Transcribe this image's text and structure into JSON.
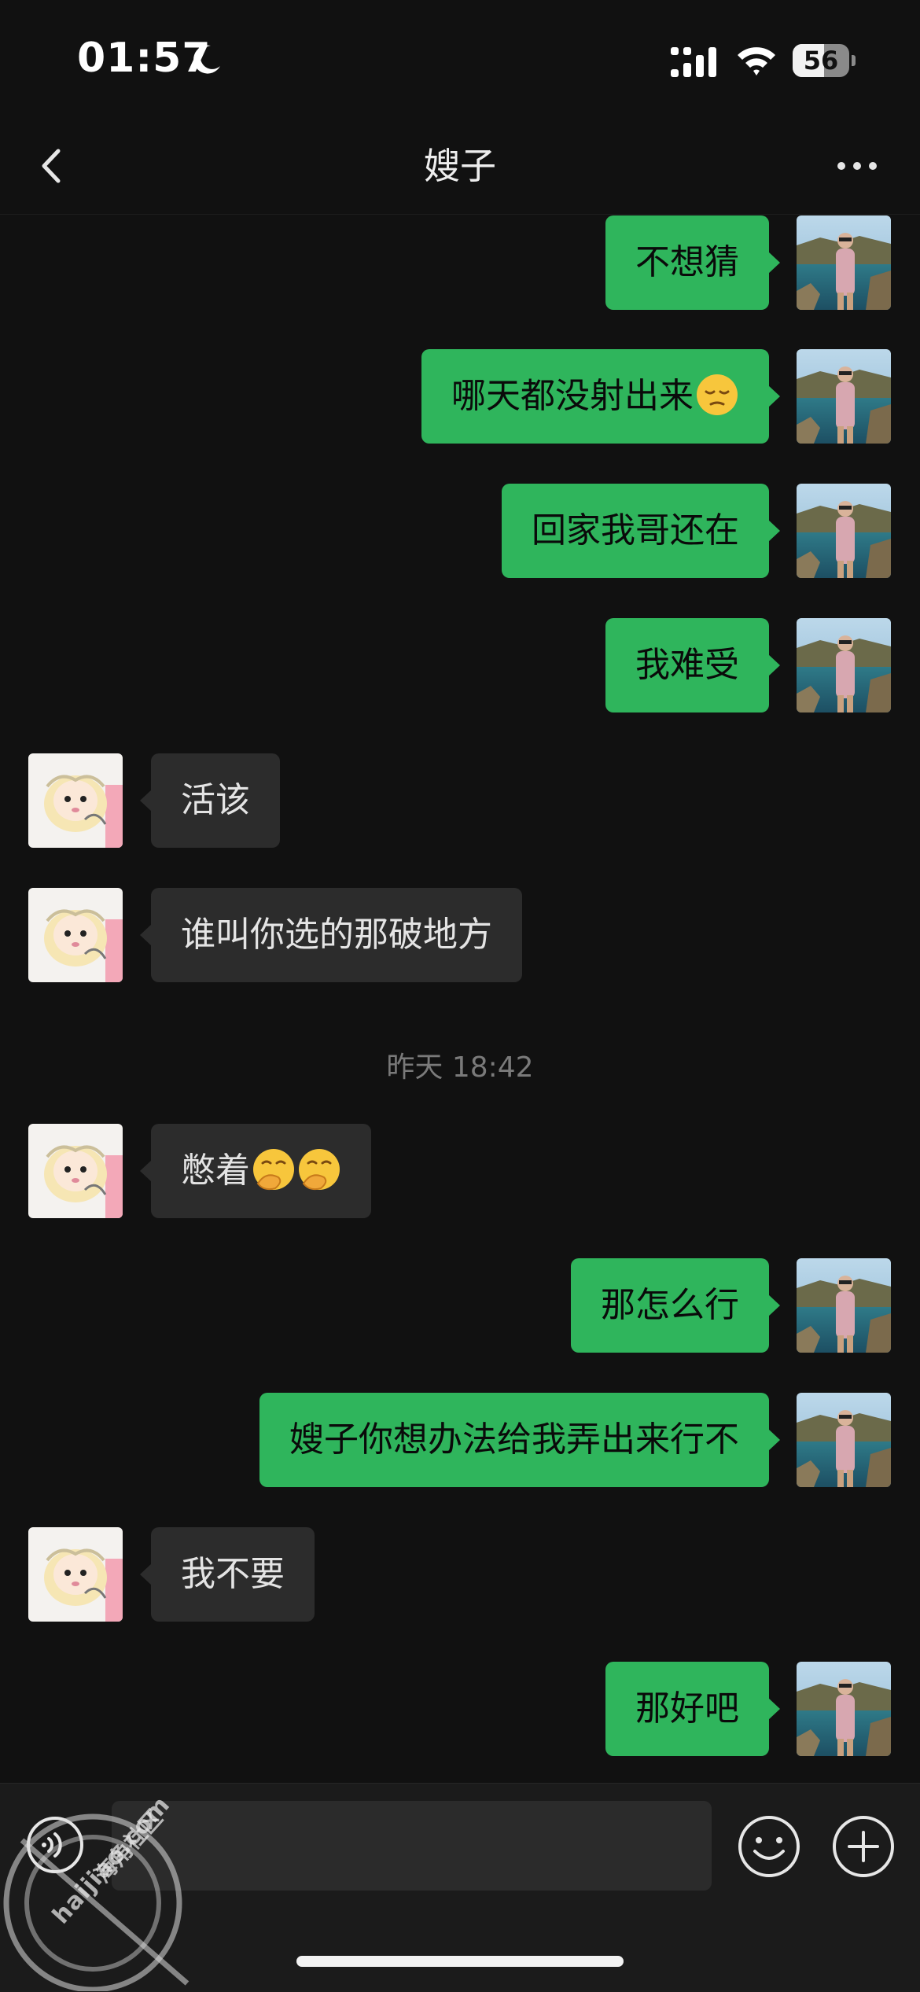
{
  "status_bar": {
    "time": "01:57",
    "battery_level": "56",
    "battery_fraction": 0.56,
    "icons": [
      "moon-icon",
      "signal-icon",
      "wifi-icon",
      "battery-icon"
    ]
  },
  "nav": {
    "title": "嫂子",
    "back_icon": "chevron-left-icon",
    "more_icon": "ellipsis-icon"
  },
  "messages": [
    {
      "side": "out",
      "text": "不想猜"
    },
    {
      "side": "out",
      "text": "哪天都没射出来",
      "emoji": "pensive-face-emoji"
    },
    {
      "side": "out",
      "text": "回家我哥还在"
    },
    {
      "side": "out",
      "text": "我难受"
    },
    {
      "side": "in",
      "text": "活该"
    },
    {
      "side": "in",
      "text": "谁叫你选的那破地方"
    },
    {
      "side": "time",
      "text": "昨天 18:42"
    },
    {
      "side": "in",
      "text": "憋着",
      "emoji": "hand-over-mouth-emoji x2"
    },
    {
      "side": "out",
      "text": "那怎么行"
    },
    {
      "side": "out",
      "text": "嫂子你想办法给我弄出来行不"
    },
    {
      "side": "in",
      "text": "我不要"
    },
    {
      "side": "out",
      "text": "那好吧"
    }
  ],
  "input_bar": {
    "placeholder": "",
    "icons": [
      "voice-icon",
      "emoji-face-icon",
      "plus-icon"
    ]
  },
  "watermark": {
    "url": "haijiao.com",
    "name": "海角社区"
  },
  "colors": {
    "background": "#111111",
    "outgoing_bubble": "#2fb55c",
    "incoming_bubble": "#2c2c2c",
    "timestamp_text": "#7a7a7a"
  }
}
